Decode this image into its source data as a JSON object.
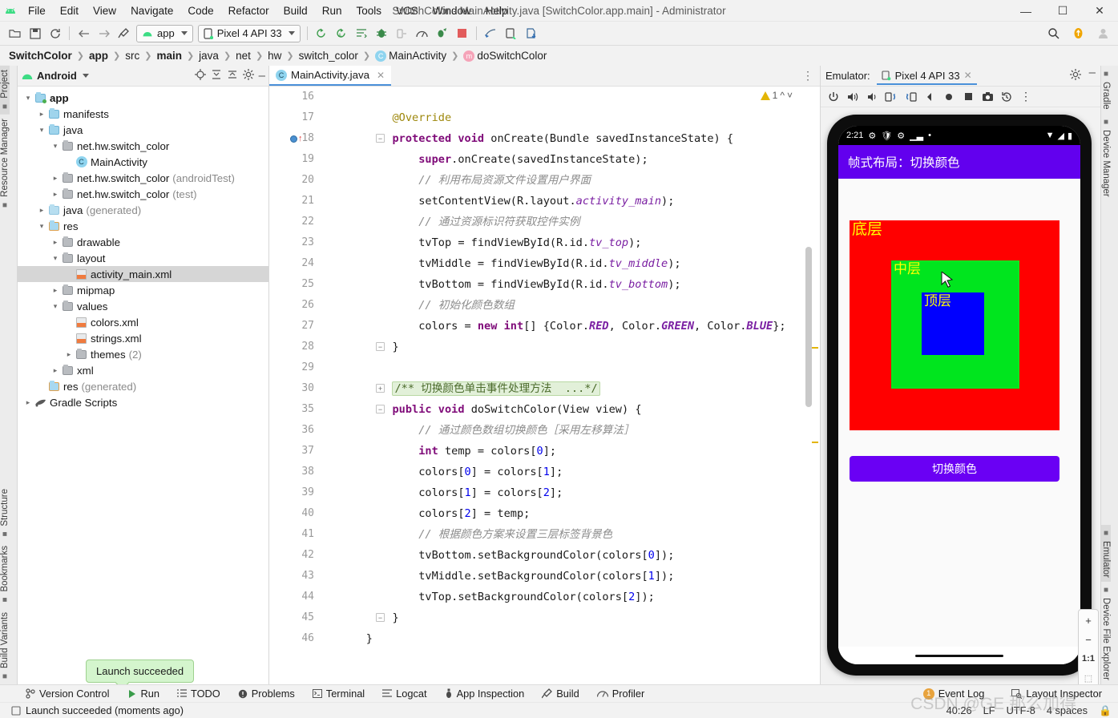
{
  "window": {
    "title": "SwitchColor - MainActivity.java [SwitchColor.app.main] - Administrator",
    "minimize": "—",
    "maximize": "☐",
    "close": "✕"
  },
  "menu": [
    "File",
    "Edit",
    "View",
    "Navigate",
    "Code",
    "Refactor",
    "Build",
    "Run",
    "Tools",
    "VCS",
    "Window",
    "Help"
  ],
  "toolbar": {
    "module_selector": "app",
    "device_selector": "Pixel 4 API 33"
  },
  "breadcrumb": [
    {
      "label": "SwitchColor",
      "bold": true
    },
    {
      "label": "app",
      "bold": true
    },
    {
      "label": "src",
      "bold": false
    },
    {
      "label": "main",
      "bold": true
    },
    {
      "label": "java",
      "bold": false
    },
    {
      "label": "net",
      "bold": false
    },
    {
      "label": "hw",
      "bold": false
    },
    {
      "label": "switch_color",
      "bold": false
    },
    {
      "label": "MainActivity",
      "bold": false,
      "icon": "C",
      "icon_color": "#8fd4ef"
    },
    {
      "label": "doSwitchColor",
      "bold": false,
      "icon": "m",
      "icon_color": "#f5a3b8"
    }
  ],
  "rail_left": [
    "Project",
    "Resource Manager",
    "Structure",
    "Bookmarks",
    "Build Variants"
  ],
  "rail_right": [
    "Gradle",
    "Device Manager",
    "Emulator",
    "Device File Explorer"
  ],
  "project": {
    "title": "Android",
    "tree": [
      {
        "depth": 0,
        "arrow": "v",
        "icon": "fold-mod",
        "label": "app",
        "bold": true,
        "note": ""
      },
      {
        "depth": 1,
        "arrow": ">",
        "icon": "fold-blue",
        "label": "manifests",
        "bold": false,
        "note": ""
      },
      {
        "depth": 1,
        "arrow": "v",
        "icon": "fold-blue",
        "label": "java",
        "bold": false,
        "note": ""
      },
      {
        "depth": 2,
        "arrow": "v",
        "icon": "fold-gray",
        "label": "net.hw.switch_color",
        "bold": false,
        "note": ""
      },
      {
        "depth": 3,
        "arrow": "",
        "icon": "class",
        "label": "MainActivity",
        "bold": false,
        "note": ""
      },
      {
        "depth": 2,
        "arrow": ">",
        "icon": "fold-gray",
        "label": "net.hw.switch_color",
        "bold": false,
        "note": "(androidTest)"
      },
      {
        "depth": 2,
        "arrow": ">",
        "icon": "fold-gray",
        "label": "net.hw.switch_color",
        "bold": false,
        "note": "(test)"
      },
      {
        "depth": 1,
        "arrow": ">",
        "icon": "fold-gen",
        "label": "java",
        "bold": false,
        "note": "(generated)"
      },
      {
        "depth": 1,
        "arrow": "v",
        "icon": "fold-res",
        "label": "res",
        "bold": false,
        "note": ""
      },
      {
        "depth": 2,
        "arrow": ">",
        "icon": "fold-gray",
        "label": "drawable",
        "bold": false,
        "note": ""
      },
      {
        "depth": 2,
        "arrow": "v",
        "icon": "fold-gray",
        "label": "layout",
        "bold": false,
        "note": ""
      },
      {
        "depth": 3,
        "arrow": "",
        "icon": "xml",
        "label": "activity_main.xml",
        "bold": false,
        "note": "",
        "selected": true
      },
      {
        "depth": 2,
        "arrow": ">",
        "icon": "fold-gray",
        "label": "mipmap",
        "bold": false,
        "note": ""
      },
      {
        "depth": 2,
        "arrow": "v",
        "icon": "fold-gray",
        "label": "values",
        "bold": false,
        "note": ""
      },
      {
        "depth": 3,
        "arrow": "",
        "icon": "xml",
        "label": "colors.xml",
        "bold": false,
        "note": ""
      },
      {
        "depth": 3,
        "arrow": "",
        "icon": "xml",
        "label": "strings.xml",
        "bold": false,
        "note": ""
      },
      {
        "depth": 3,
        "arrow": ">",
        "icon": "fold-gray",
        "label": "themes",
        "bold": false,
        "note": "(2)"
      },
      {
        "depth": 2,
        "arrow": ">",
        "icon": "fold-gray",
        "label": "xml",
        "bold": false,
        "note": ""
      },
      {
        "depth": 1,
        "arrow": "",
        "icon": "fold-res",
        "label": "res",
        "bold": false,
        "note": "(generated)"
      },
      {
        "depth": 0,
        "arrow": ">",
        "icon": "gradle",
        "label": "Gradle Scripts",
        "bold": false,
        "note": ""
      }
    ]
  },
  "editor": {
    "tab_label": "MainActivity.java",
    "warning_count": "1",
    "lines": [
      {
        "n": "16",
        "segments": [],
        "fold": "",
        "bp": false
      },
      {
        "n": "17",
        "segments": [
          {
            "t": "        ",
            "c": "plain"
          },
          {
            "t": "@Override",
            "c": "anno"
          }
        ],
        "fold": "",
        "bp": false
      },
      {
        "n": "18",
        "segments": [
          {
            "t": "        ",
            "c": "plain"
          },
          {
            "t": "protected",
            "c": "kw"
          },
          {
            "t": " ",
            "c": "plain"
          },
          {
            "t": "void",
            "c": "kw"
          },
          {
            "t": " onCreate(Bundle savedInstanceState) {",
            "c": "plain"
          }
        ],
        "fold": "minus",
        "bp": true
      },
      {
        "n": "19",
        "segments": [
          {
            "t": "            ",
            "c": "plain"
          },
          {
            "t": "super",
            "c": "kw"
          },
          {
            "t": ".onCreate(savedInstanceState);",
            "c": "plain"
          }
        ],
        "fold": "",
        "bp": false
      },
      {
        "n": "20",
        "segments": [
          {
            "t": "            ",
            "c": "plain"
          },
          {
            "t": "// 利用布局资源文件设置用户界面",
            "c": "cmt"
          }
        ],
        "fold": "",
        "bp": false
      },
      {
        "n": "21",
        "segments": [
          {
            "t": "            setContentView(R.layout.",
            "c": "plain"
          },
          {
            "t": "activity_main",
            "c": "fld"
          },
          {
            "t": ");",
            "c": "plain"
          }
        ],
        "fold": "",
        "bp": false
      },
      {
        "n": "22",
        "segments": [
          {
            "t": "            ",
            "c": "plain"
          },
          {
            "t": "// 通过资源标识符获取控件实例",
            "c": "cmt"
          }
        ],
        "fold": "",
        "bp": false
      },
      {
        "n": "23",
        "segments": [
          {
            "t": "            tvTop = findViewById(R.id.",
            "c": "plain"
          },
          {
            "t": "tv_top",
            "c": "fld"
          },
          {
            "t": ");",
            "c": "plain"
          }
        ],
        "fold": "",
        "bp": false
      },
      {
        "n": "24",
        "segments": [
          {
            "t": "            tvMiddle = findViewById(R.id.",
            "c": "plain"
          },
          {
            "t": "tv_middle",
            "c": "fld"
          },
          {
            "t": ");",
            "c": "plain"
          }
        ],
        "fold": "",
        "bp": false
      },
      {
        "n": "25",
        "segments": [
          {
            "t": "            tvBottom = findViewById(R.id.",
            "c": "plain"
          },
          {
            "t": "tv_bottom",
            "c": "fld"
          },
          {
            "t": ");",
            "c": "plain"
          }
        ],
        "fold": "",
        "bp": false
      },
      {
        "n": "26",
        "segments": [
          {
            "t": "            ",
            "c": "plain"
          },
          {
            "t": "// 初始化颜色数组",
            "c": "cmt"
          }
        ],
        "fold": "",
        "bp": false
      },
      {
        "n": "27",
        "segments": [
          {
            "t": "            colors = ",
            "c": "plain"
          },
          {
            "t": "new",
            "c": "kw"
          },
          {
            "t": " ",
            "c": "plain"
          },
          {
            "t": "int",
            "c": "kw"
          },
          {
            "t": "[] {Color.",
            "c": "plain"
          },
          {
            "t": "RED",
            "c": "stat"
          },
          {
            "t": ", Color.",
            "c": "plain"
          },
          {
            "t": "GREEN",
            "c": "stat"
          },
          {
            "t": ", Color.",
            "c": "plain"
          },
          {
            "t": "BLUE",
            "c": "stat"
          },
          {
            "t": "};",
            "c": "plain"
          }
        ],
        "fold": "",
        "bp": false
      },
      {
        "n": "28",
        "segments": [
          {
            "t": "        }",
            "c": "plain"
          }
        ],
        "fold": "minus",
        "bp": false
      },
      {
        "n": "29",
        "segments": [],
        "fold": "",
        "bp": false
      },
      {
        "n": "30",
        "segments": [
          {
            "t": "        ",
            "c": "plain"
          }
        ],
        "fold": "plus",
        "bp": false,
        "folded_text": "/** 切换颜色单击事件处理方法  ...*/"
      },
      {
        "n": "35",
        "segments": [
          {
            "t": "        ",
            "c": "plain"
          },
          {
            "t": "public",
            "c": "kw"
          },
          {
            "t": " ",
            "c": "plain"
          },
          {
            "t": "void",
            "c": "kw"
          },
          {
            "t": " doSwitchColor(View view) {",
            "c": "plain"
          }
        ],
        "fold": "minus",
        "bp": false
      },
      {
        "n": "36",
        "segments": [
          {
            "t": "            ",
            "c": "plain"
          },
          {
            "t": "// 通过颜色数组切换颜色［采用左移算法］",
            "c": "cmt"
          }
        ],
        "fold": "",
        "bp": false
      },
      {
        "n": "37",
        "segments": [
          {
            "t": "            ",
            "c": "plain"
          },
          {
            "t": "int",
            "c": "kw"
          },
          {
            "t": " temp = colors[",
            "c": "plain"
          },
          {
            "t": "0",
            "c": "num"
          },
          {
            "t": "];",
            "c": "plain"
          }
        ],
        "fold": "",
        "bp": false
      },
      {
        "n": "38",
        "segments": [
          {
            "t": "            colors[",
            "c": "plain"
          },
          {
            "t": "0",
            "c": "num"
          },
          {
            "t": "] = colors[",
            "c": "plain"
          },
          {
            "t": "1",
            "c": "num"
          },
          {
            "t": "];",
            "c": "plain"
          }
        ],
        "fold": "",
        "bp": false
      },
      {
        "n": "39",
        "segments": [
          {
            "t": "            colors[",
            "c": "plain"
          },
          {
            "t": "1",
            "c": "num"
          },
          {
            "t": "] = colors[",
            "c": "plain"
          },
          {
            "t": "2",
            "c": "num"
          },
          {
            "t": "];",
            "c": "plain"
          }
        ],
        "fold": "",
        "bp": false
      },
      {
        "n": "40",
        "segments": [
          {
            "t": "            colors[",
            "c": "plain"
          },
          {
            "t": "2",
            "c": "num"
          },
          {
            "t": "] = temp;",
            "c": "plain"
          }
        ],
        "fold": "",
        "bp": false
      },
      {
        "n": "41",
        "segments": [
          {
            "t": "            ",
            "c": "plain"
          },
          {
            "t": "// 根据颜色方案来设置三层标签背景色",
            "c": "cmt"
          }
        ],
        "fold": "",
        "bp": false
      },
      {
        "n": "42",
        "segments": [
          {
            "t": "            tvBottom.setBackgroundColor(colors[",
            "c": "plain"
          },
          {
            "t": "0",
            "c": "num"
          },
          {
            "t": "]);",
            "c": "plain"
          }
        ],
        "fold": "",
        "bp": false
      },
      {
        "n": "43",
        "segments": [
          {
            "t": "            tvMiddle.setBackgroundColor(colors[",
            "c": "plain"
          },
          {
            "t": "1",
            "c": "num"
          },
          {
            "t": "]);",
            "c": "plain"
          }
        ],
        "fold": "",
        "bp": false
      },
      {
        "n": "44",
        "segments": [
          {
            "t": "            tvTop.setBackgroundColor(colors[",
            "c": "plain"
          },
          {
            "t": "2",
            "c": "num"
          },
          {
            "t": "]);",
            "c": "plain"
          }
        ],
        "fold": "",
        "bp": false
      },
      {
        "n": "45",
        "segments": [
          {
            "t": "        }",
            "c": "plain"
          }
        ],
        "fold": "minus",
        "bp": false
      },
      {
        "n": "46",
        "segments": [
          {
            "t": "    }",
            "c": "plain"
          }
        ],
        "fold": "",
        "bp": false
      }
    ]
  },
  "emulator": {
    "panel_label": "Emulator:",
    "tab_label": "Pixel 4 API 33",
    "device": {
      "status_time": "2:21",
      "app_title": "帧式布局：切换颜色",
      "appbar_color": "#6200ee",
      "layers": [
        {
          "label": "底层",
          "color": "#ff0000",
          "text_color": "#ffff00"
        },
        {
          "label": "中层",
          "color": "#00e51e",
          "text_color": "#ffff00"
        },
        {
          "label": "顶层",
          "color": "#0000ff",
          "text_color": "#ffff00"
        }
      ],
      "button_label": "切换颜色",
      "button_color": "#6a00f4"
    },
    "zoom_controls": [
      "+",
      "−",
      "1:1",
      "⬚"
    ]
  },
  "status_bar": {
    "items": [
      "Version Control",
      "Run",
      "TODO",
      "Problems",
      "Terminal",
      "Logcat",
      "App Inspection",
      "Build",
      "Profiler"
    ],
    "event_log": "Event Log",
    "layout_inspector": "Layout Inspector",
    "event_log_count": "1"
  },
  "bottom_bar": {
    "message": "Launch succeeded (moments ago)",
    "caret_position": "40:26",
    "line_separator": "LF",
    "encoding": "UTF-8",
    "indent": "4 spaces"
  },
  "balloon": {
    "text": "Launch succeeded"
  },
  "watermark": {
    "text": "CSDN @GE 那么加得"
  }
}
